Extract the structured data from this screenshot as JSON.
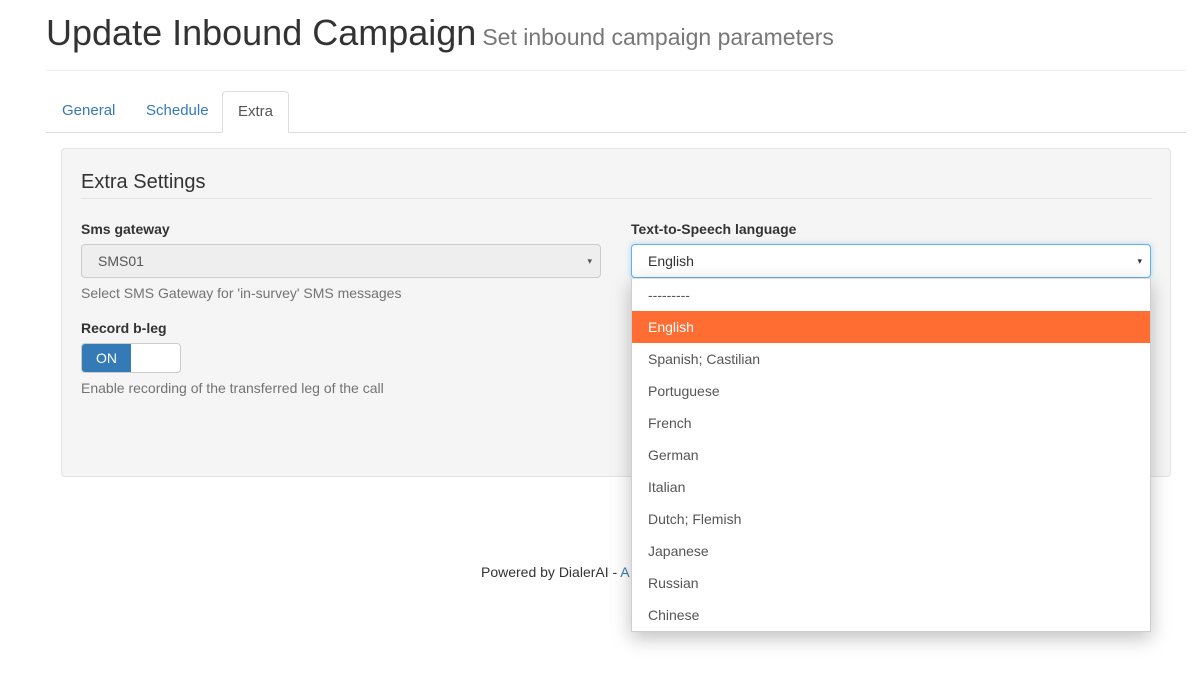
{
  "header": {
    "title": "Update Inbound Campaign",
    "subtitle": "Set inbound campaign parameters"
  },
  "tabs": [
    {
      "label": "General",
      "active": false
    },
    {
      "label": "Schedule",
      "active": false
    },
    {
      "label": "Extra",
      "active": true
    }
  ],
  "panel": {
    "title": "Extra Settings",
    "sms_gateway": {
      "label": "Sms gateway",
      "value": "SMS01",
      "help": "Select SMS Gateway for 'in-survey' SMS messages"
    },
    "record_bleg": {
      "label": "Record b-leg",
      "state": "ON",
      "help": "Enable recording of the transferred leg of the call"
    },
    "tts_language": {
      "label": "Text-to-Speech language",
      "value": "English",
      "options": [
        "---------",
        "English",
        "Spanish; Castilian",
        "Portuguese",
        "French",
        "German",
        "Italian",
        "Dutch; Flemish",
        "Japanese",
        "Russian",
        "Chinese"
      ],
      "selected_index": 1
    }
  },
  "footer": {
    "text": "Powered by DialerAI - ",
    "link": "A"
  },
  "colors": {
    "accent": "#337ab7",
    "highlight": "#ff6d32"
  },
  "icons": {
    "select_caret": "▾"
  }
}
